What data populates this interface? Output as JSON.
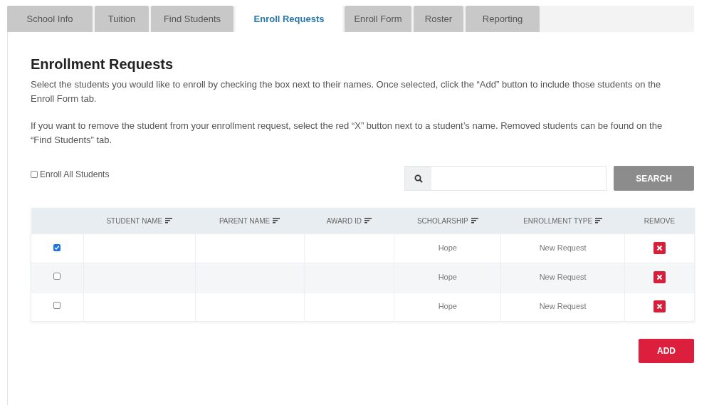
{
  "tabs": [
    {
      "label": "School Info",
      "selected": false
    },
    {
      "label": "Tuition",
      "selected": false
    },
    {
      "label": "Find Students",
      "selected": false
    },
    {
      "label": "Enroll Requests",
      "selected": true
    },
    {
      "label": "Enroll Form",
      "selected": false
    },
    {
      "label": "Roster",
      "selected": false
    },
    {
      "label": "Reporting",
      "selected": false
    }
  ],
  "heading": "Enrollment Requests",
  "paragraphs": [
    "Select the students you would like to enroll by checking the box next to their names. Once selected, click the “Add” button to include those students on the Enroll Form tab.",
    "If you want to remove the student from your enrollment request, select the red “X” button next to a student’s name. Removed students can be found on the “Find Students” tab."
  ],
  "enroll_all": {
    "label": "Enroll All Students",
    "checked": false
  },
  "search": {
    "button": "SEARCH"
  },
  "table": {
    "columns": [
      {
        "label": "STUDENT NAME",
        "sortable": true
      },
      {
        "label": "PARENT NAME",
        "sortable": true
      },
      {
        "label": "AWARD ID",
        "sortable": true
      },
      {
        "label": "SCHOLARSHIP",
        "sortable": true
      },
      {
        "label": "ENROLLMENT TYPE",
        "sortable": true
      },
      {
        "label": "REMOVE",
        "sortable": false
      }
    ],
    "rows": [
      {
        "checked": true,
        "scholarship": "Hope",
        "enrollment_type": "New Request"
      },
      {
        "checked": false,
        "scholarship": "Hope",
        "enrollment_type": "New Request"
      },
      {
        "checked": false,
        "scholarship": "Hope",
        "enrollment_type": "New Request"
      }
    ]
  },
  "add_button": "ADD"
}
